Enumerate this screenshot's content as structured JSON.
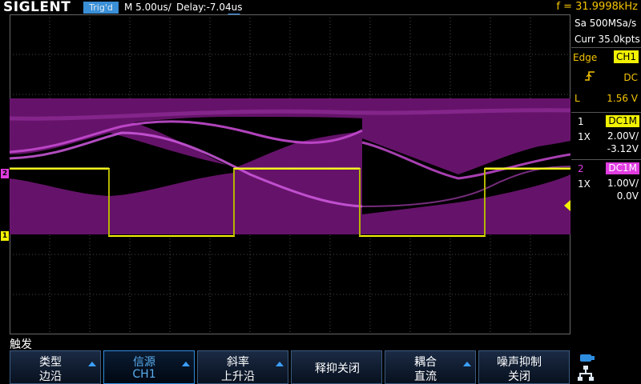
{
  "header": {
    "brand": "SIGLENT",
    "trigger_status": "Trig'd",
    "timebase": "M 5.00us/",
    "delay": "Delay:-7.04us",
    "frequency": "f = 31.9998kHz"
  },
  "acquisition": {
    "sample_rate": "Sa 500MSa/s",
    "memory_depth": "Curr 35.0kpts"
  },
  "trigger": {
    "type": "Edge",
    "source": "CH1",
    "slope_icon": "rising-edge-icon",
    "coupling": "DC",
    "level_label": "L",
    "level_value": "1.56 V"
  },
  "channels": [
    {
      "number": "1",
      "coupling": "DC1M",
      "probe": "1X",
      "scale": "2.00V/",
      "offset": "-3.12V",
      "color": "#f2f200"
    },
    {
      "number": "2",
      "coupling": "DC1M",
      "probe": "1X",
      "scale": "1.00V/",
      "offset": "0.0V",
      "color": "#e03ce0"
    }
  ],
  "markers": {
    "ch1": "1",
    "ch2": "2"
  },
  "menu": {
    "title": "触发",
    "softkeys": [
      {
        "line1": "类型",
        "line2": "边沿"
      },
      {
        "line1": "信源",
        "line2": "CH1"
      },
      {
        "line1": "斜率",
        "line2": "上升沿"
      },
      {
        "single": "释抑关闭"
      },
      {
        "line1": "耦合",
        "line2": "直流"
      },
      {
        "line1": "噪声抑制",
        "line2": "关闭"
      }
    ]
  },
  "status_icons": [
    "usb-icon",
    "network-icon"
  ],
  "colors": {
    "accent": "#3a8fd6",
    "trigger": "#f5c400",
    "ch1": "#f2f200",
    "ch2": "#e03ce0"
  }
}
